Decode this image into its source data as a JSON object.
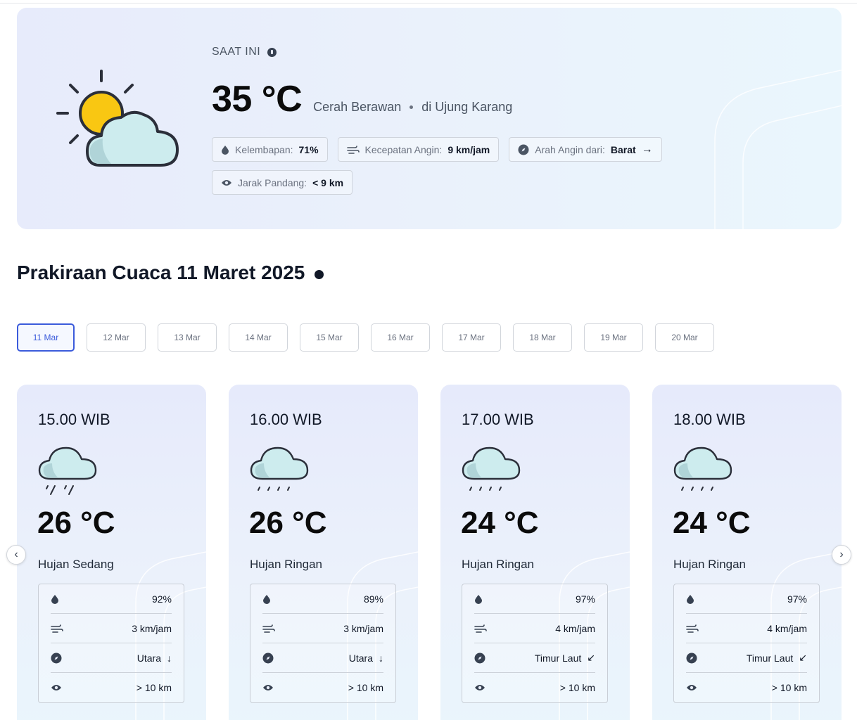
{
  "current": {
    "label": "SAAT INI",
    "temperature": "35 °C",
    "condition": "Cerah Berawan",
    "location": "di Ujung Karang",
    "icon": "sun-cloud-icon",
    "details": {
      "humidity_label": "Kelembapan:",
      "humidity_value": "71%",
      "wind_speed_label": "Kecepatan Angin:",
      "wind_speed_value": "9 km/jam",
      "wind_dir_label": "Arah Angin dari:",
      "wind_dir_value": "Barat",
      "visibility_label": "Jarak Pandang:",
      "visibility_value": "< 9 km"
    }
  },
  "forecast": {
    "title": "Prakiraan Cuaca 11 Maret 2025",
    "dates": [
      "11 Mar",
      "12 Mar",
      "13 Mar",
      "14 Mar",
      "15 Mar",
      "16 Mar",
      "17 Mar",
      "18 Mar",
      "19 Mar",
      "20 Mar"
    ],
    "active_date": "11 Mar",
    "cards": [
      {
        "time": "15.00 WIB",
        "temperature": "26 °C",
        "condition": "Hujan Sedang",
        "humidity": "92%",
        "wind_speed": "3 km/jam",
        "wind_dir": "Utara",
        "visibility": "> 10 km",
        "icon": "rain-cloud-icon"
      },
      {
        "time": "16.00 WIB",
        "temperature": "26 °C",
        "condition": "Hujan Ringan",
        "humidity": "89%",
        "wind_speed": "3 km/jam",
        "wind_dir": "Utara",
        "visibility": "> 10 km",
        "icon": "light-rain-cloud-icon"
      },
      {
        "time": "17.00 WIB",
        "temperature": "24 °C",
        "condition": "Hujan Ringan",
        "humidity": "97%",
        "wind_speed": "4 km/jam",
        "wind_dir": "Timur Laut",
        "visibility": "> 10 km",
        "icon": "light-rain-cloud-icon"
      },
      {
        "time": "18.00 WIB",
        "temperature": "24 °C",
        "condition": "Hujan Ringan",
        "humidity": "97%",
        "wind_speed": "4 km/jam",
        "wind_dir": "Timur Laut",
        "visibility": "> 10 km",
        "icon": "light-rain-cloud-icon"
      }
    ]
  },
  "colors": {
    "accent": "#3b5bdb",
    "sun": "#f9c712",
    "cloud": "#cdecee",
    "card_bg": "#e8eefb"
  }
}
